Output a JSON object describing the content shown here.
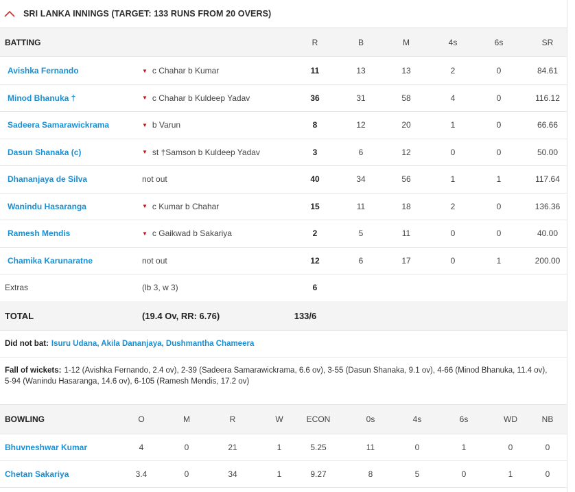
{
  "innings": {
    "title": "SRI LANKA INNINGS (TARGET: 133 RUNS FROM 20 OVERS)",
    "accent_color": "#d22b2b"
  },
  "batting_headers": [
    "BATTING",
    "R",
    "B",
    "M",
    "4s",
    "6s",
    "SR"
  ],
  "batters": [
    {
      "name": "Avishka Fernando",
      "dismissal": "c Chahar b Kumar",
      "out": true,
      "R": "11",
      "B": "13",
      "M": "13",
      "4s": "2",
      "6s": "0",
      "SR": "84.61"
    },
    {
      "name": "Minod Bhanuka †",
      "dismissal": "c Chahar b Kuldeep Yadav",
      "out": true,
      "R": "36",
      "B": "31",
      "M": "58",
      "4s": "4",
      "6s": "0",
      "SR": "116.12"
    },
    {
      "name": "Sadeera Samarawickrama",
      "dismissal": "b Varun",
      "out": true,
      "R": "8",
      "B": "12",
      "M": "20",
      "4s": "1",
      "6s": "0",
      "SR": "66.66"
    },
    {
      "name": "Dasun Shanaka (c)",
      "dismissal": "st †Samson b Kuldeep Yadav",
      "out": true,
      "R": "3",
      "B": "6",
      "M": "12",
      "4s": "0",
      "6s": "0",
      "SR": "50.00"
    },
    {
      "name": "Dhananjaya de Silva",
      "dismissal": "not out",
      "out": false,
      "R": "40",
      "B": "34",
      "M": "56",
      "4s": "1",
      "6s": "1",
      "SR": "117.64"
    },
    {
      "name": "Wanindu Hasaranga",
      "dismissal": "c Kumar b Chahar",
      "out": true,
      "R": "15",
      "B": "11",
      "M": "18",
      "4s": "2",
      "6s": "0",
      "SR": "136.36"
    },
    {
      "name": "Ramesh Mendis",
      "dismissal": "c Gaikwad b Sakariya",
      "out": true,
      "R": "2",
      "B": "5",
      "M": "11",
      "4s": "0",
      "6s": "0",
      "SR": "40.00"
    },
    {
      "name": "Chamika Karunaratne",
      "dismissal": "not out",
      "out": false,
      "R": "12",
      "B": "6",
      "M": "17",
      "4s": "0",
      "6s": "1",
      "SR": "200.00"
    }
  ],
  "extras": {
    "label": "Extras",
    "detail": "(lb 3, w 3)",
    "value": "6"
  },
  "total": {
    "label": "TOTAL",
    "detail": "(19.4 Ov, RR: 6.76)",
    "value": "133/6"
  },
  "did_not_bat": {
    "label": "Did not bat:",
    "players": "Isuru Udana, Akila Dananjaya, Dushmantha Chameera"
  },
  "fall_of_wickets": {
    "label": "Fall of wickets:",
    "line1": "1-12 (Avishka Fernando, 2.4 ov), 2-39 (Sadeera Samarawickrama, 6.6 ov), 3-55 (Dasun Shanaka, 9.1 ov), 4-66 (Minod Bhanuka, 11.4 ov),",
    "line2": "5-94 (Wanindu Hasaranga, 14.6 ov), 6-105 (Ramesh Mendis, 17.2 ov)"
  },
  "bowling_headers": [
    "BOWLING",
    "O",
    "M",
    "R",
    "W",
    "ECON",
    "0s",
    "4s",
    "6s",
    "WD",
    "NB"
  ],
  "bowlers": [
    {
      "name": "Bhuvneshwar Kumar",
      "O": "4",
      "M": "0",
      "R": "21",
      "W": "1",
      "ECON": "5.25",
      "0s": "11",
      "4s": "0",
      "6s": "1",
      "WD": "0",
      "NB": "0"
    },
    {
      "name": "Chetan Sakariya",
      "O": "3.4",
      "M": "0",
      "R": "34",
      "W": "1",
      "ECON": "9.27",
      "0s": "8",
      "4s": "5",
      "6s": "0",
      "WD": "1",
      "NB": "0"
    }
  ]
}
